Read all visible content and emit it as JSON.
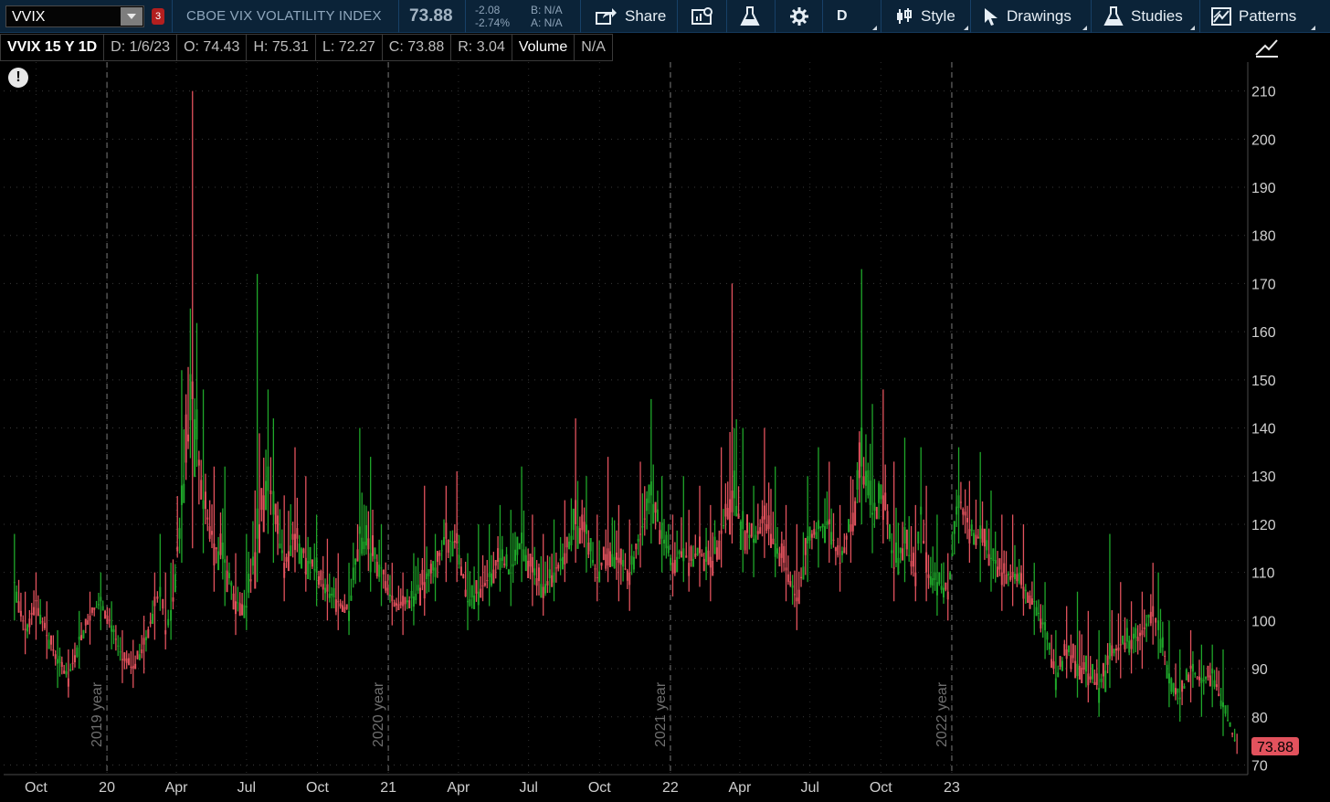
{
  "toolbar": {
    "symbol": "VVIX",
    "alert_badge": "3",
    "description": "CBOE VIX VOLATILITY INDEX",
    "last": "73.88",
    "net_change": "-2.08",
    "pct_change": "-2.74%",
    "bid": "B: N/A",
    "ask": "A: N/A",
    "share_label": "Share",
    "aggregation_label": "D",
    "style_label": "Style",
    "drawings_label": "Drawings",
    "studies_label": "Studies",
    "patterns_label": "Patterns"
  },
  "info": {
    "title": "VVIX 15 Y 1D",
    "date": "D: 1/6/23",
    "open": "O: 74.43",
    "high": "H: 75.31",
    "low": "L: 72.27",
    "close": "C: 73.88",
    "range": "R: 3.04",
    "volume_label": "Volume",
    "volume_value": "N/A"
  },
  "colors": {
    "up": "#1fa72a",
    "down": "#e2525d",
    "background": "#000000",
    "toolbar": "#0b2338",
    "price_bubble": "#e2525d"
  },
  "chart_data": {
    "type": "candlestick",
    "series": "VVIX daily",
    "x": [
      "2018-09-03",
      "2018-09-17",
      "2018-10-01",
      "2018-10-15",
      "2018-10-29",
      "2018-11-12",
      "2018-11-26",
      "2018-12-10",
      "2018-12-24",
      "2019-01-07",
      "2019-01-21",
      "2019-02-04",
      "2019-02-18",
      "2019-03-04",
      "2019-03-11",
      "2019-03-18",
      "2019-03-25",
      "2019-04-08",
      "2019-04-22",
      "2019-05-06",
      "2019-05-20",
      "2019-06-03",
      "2019-06-17",
      "2019-07-01",
      "2019-07-15",
      "2019-07-29",
      "2019-08-05",
      "2019-08-19",
      "2019-09-02",
      "2019-09-16",
      "2019-09-30",
      "2019-10-14",
      "2019-10-28",
      "2019-11-11",
      "2019-11-25",
      "2019-12-09",
      "2019-12-23",
      "2020-01-06",
      "2020-01-20",
      "2020-02-03",
      "2020-02-17",
      "2020-03-02",
      "2020-03-16",
      "2020-03-30",
      "2020-04-13",
      "2020-04-27",
      "2020-05-11",
      "2020-05-25",
      "2020-06-08",
      "2020-06-22",
      "2020-07-06",
      "2020-07-20",
      "2020-08-03",
      "2020-08-17",
      "2020-08-31",
      "2020-09-14",
      "2020-09-28",
      "2020-10-12",
      "2020-10-26",
      "2020-11-09",
      "2020-11-23",
      "2020-12-07",
      "2020-12-21",
      "2021-01-04",
      "2021-01-18",
      "2021-01-25",
      "2021-02-08",
      "2021-02-22",
      "2021-03-08",
      "2021-03-22",
      "2021-04-05",
      "2021-04-19",
      "2021-05-03",
      "2021-05-17",
      "2021-05-31",
      "2021-06-14",
      "2021-06-28",
      "2021-07-12",
      "2021-07-26",
      "2021-08-09",
      "2021-08-23",
      "2021-09-06",
      "2021-09-20",
      "2021-10-04",
      "2021-10-18",
      "2021-11-01",
      "2021-11-15",
      "2021-11-22",
      "2021-11-29",
      "2021-12-13",
      "2021-12-27",
      "2022-01-10",
      "2022-01-24",
      "2022-02-07",
      "2022-02-21",
      "2022-03-07",
      "2022-03-21",
      "2022-04-04",
      "2022-04-18",
      "2022-05-02",
      "2022-05-16",
      "2022-05-30",
      "2022-06-13",
      "2022-06-27",
      "2022-07-11",
      "2022-07-25",
      "2022-08-08",
      "2022-08-22",
      "2022-09-05",
      "2022-09-19",
      "2022-09-26",
      "2022-10-10",
      "2022-10-24",
      "2022-11-07",
      "2022-11-21",
      "2022-12-05",
      "2022-12-19",
      "2023-01-06"
    ],
    "close": [
      108,
      98,
      104,
      97,
      92,
      88,
      96,
      101,
      104,
      99,
      92,
      90,
      95,
      103,
      107,
      98,
      100,
      124,
      146,
      125,
      116,
      112,
      104,
      103,
      117,
      132,
      122,
      112,
      118,
      113,
      110,
      106,
      104,
      102,
      118,
      114,
      111,
      104,
      103,
      105,
      108,
      111,
      117,
      116,
      104,
      106,
      109,
      113,
      110,
      116,
      110,
      107,
      110,
      114,
      120,
      118,
      109,
      115,
      112,
      110,
      118,
      126,
      117,
      112,
      115,
      112,
      114,
      111,
      118,
      127,
      119,
      117,
      121,
      116,
      111,
      104,
      116,
      119,
      120,
      112,
      120,
      132,
      122,
      126,
      111,
      116,
      110,
      122,
      110,
      108,
      106,
      126,
      119,
      117,
      113,
      110,
      109,
      107,
      104,
      98,
      88,
      94,
      91,
      89,
      86,
      92,
      95,
      96,
      97,
      103,
      98,
      89,
      84,
      90,
      87,
      89,
      82,
      73.88
    ],
    "high": [
      118,
      106,
      110,
      104,
      98,
      94,
      102,
      106,
      110,
      104,
      98,
      96,
      101,
      110,
      118,
      110,
      112,
      152,
      210,
      148,
      132,
      132,
      114,
      118,
      172,
      148,
      142,
      126,
      136,
      130,
      122,
      117,
      114,
      112,
      140,
      134,
      120,
      112,
      110,
      114,
      128,
      118,
      128,
      131,
      114,
      120,
      120,
      124,
      123,
      132,
      122,
      118,
      121,
      125,
      142,
      130,
      122,
      134,
      124,
      121,
      133,
      146,
      130,
      122,
      130,
      123,
      128,
      124,
      136,
      170,
      140,
      128,
      140,
      132,
      124,
      120,
      130,
      136,
      133,
      124,
      130,
      173,
      145,
      148,
      133,
      138,
      124,
      136,
      128,
      122,
      114,
      136,
      129,
      135,
      127,
      122,
      122,
      120,
      112,
      108,
      98,
      103,
      106,
      102,
      98,
      118,
      108,
      104,
      106,
      112,
      110,
      100,
      94,
      98,
      95,
      95,
      94,
      76.5
    ],
    "low": [
      100,
      93,
      96,
      92,
      86,
      84,
      90,
      95,
      98,
      94,
      87,
      86,
      89,
      96,
      102,
      94,
      96,
      112,
      115,
      114,
      106,
      103,
      97,
      98,
      108,
      118,
      112,
      104,
      110,
      106,
      103,
      100,
      98,
      97,
      108,
      106,
      103,
      99,
      97,
      99,
      101,
      104,
      108,
      108,
      98,
      100,
      103,
      106,
      103,
      108,
      103,
      101,
      104,
      108,
      112,
      110,
      104,
      108,
      104,
      102,
      111,
      116,
      110,
      105,
      108,
      106,
      107,
      104,
      111,
      116,
      110,
      109,
      113,
      109,
      104,
      98,
      108,
      111,
      112,
      106,
      112,
      120,
      114,
      116,
      104,
      108,
      104,
      114,
      104,
      101,
      100,
      116,
      112,
      108,
      106,
      102,
      103,
      101,
      97,
      92,
      84,
      88,
      84,
      83,
      80,
      86,
      88,
      89,
      90,
      95,
      92,
      82,
      79,
      83,
      80,
      82,
      76,
      72.3
    ],
    "ylim": [
      68,
      216
    ],
    "y_ticks": [
      70,
      80,
      90,
      100,
      110,
      120,
      130,
      140,
      150,
      160,
      170,
      180,
      190,
      200,
      210
    ],
    "x_tick_labels": [
      {
        "date": "2018-10-01",
        "label": "Oct"
      },
      {
        "date": "2019-01-01",
        "label": "20"
      },
      {
        "date": "2019-04-01",
        "label": "Apr"
      },
      {
        "date": "2019-07-01",
        "label": "Jul"
      },
      {
        "date": "2019-10-01",
        "label": "Oct"
      },
      {
        "date": "2020-01-01",
        "label": "21"
      },
      {
        "date": "2020-04-01",
        "label": "Apr"
      },
      {
        "date": "2020-07-01",
        "label": "Jul"
      },
      {
        "date": "2020-10-01",
        "label": "Oct"
      },
      {
        "date": "2021-01-01",
        "label": "22"
      },
      {
        "date": "2021-04-01",
        "label": "Apr"
      },
      {
        "date": "2021-07-01",
        "label": "Jul"
      },
      {
        "date": "2021-10-01",
        "label": "Oct"
      },
      {
        "date": "2022-01-01",
        "label": "23"
      }
    ],
    "year_markers": [
      {
        "date": "2019-01-01",
        "label": "2019 year"
      },
      {
        "date": "2020-01-01",
        "label": "2020 year"
      },
      {
        "date": "2021-01-01",
        "label": "2021 year"
      },
      {
        "date": "2022-01-01",
        "label": "2022 year"
      }
    ],
    "x_range": [
      "2018-08-20",
      "2023-01-20"
    ],
    "last_price_label": "73.88",
    "grid": true
  }
}
